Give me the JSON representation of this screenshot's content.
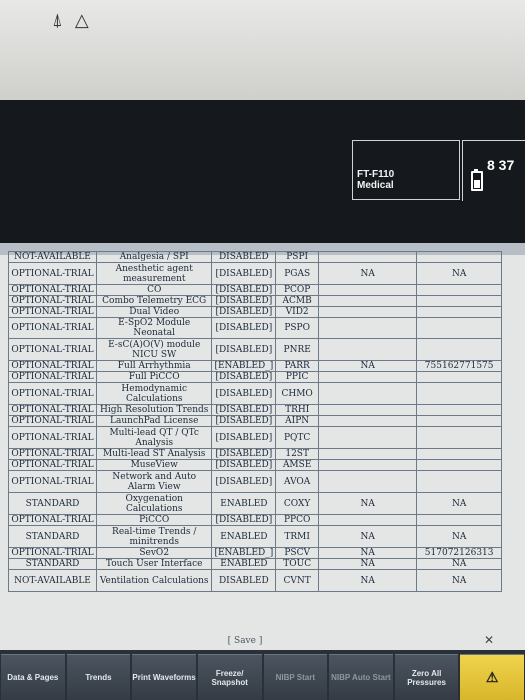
{
  "header": {
    "device_line1": "FT-F110",
    "device_line2": "Medical",
    "clock": "8 37"
  },
  "bezel": {
    "icons": [
      "alarm-silence-icon",
      "warning-triangle-icon"
    ]
  },
  "table": {
    "rows": [
      [
        "NOT-AVAILABLE",
        "Analgesia / SPI",
        "DISABLED",
        "PSPI",
        "",
        ""
      ],
      [
        "OPTIONAL-TRIAL",
        "Anesthetic agent measurement",
        "[DISABLED]",
        "PGAS",
        "NA",
        "NA"
      ],
      [
        "OPTIONAL-TRIAL",
        "CO",
        "[DISABLED]",
        "PCOP",
        "",
        ""
      ],
      [
        "OPTIONAL-TRIAL",
        "Combo Telemetry ECG",
        "[DISABLED]",
        "ACMB",
        "",
        ""
      ],
      [
        "OPTIONAL-TRIAL",
        "Dual Video",
        "[DISABLED]",
        "VID2",
        "",
        ""
      ],
      [
        "OPTIONAL-TRIAL",
        "E-SpO2 Module Neonatal",
        "[DISABLED]",
        "PSPO",
        "",
        ""
      ],
      [
        "OPTIONAL-TRIAL",
        "E-sC(A)O(V) module NICU SW",
        "[DISABLED]",
        "PNRE",
        "",
        ""
      ],
      [
        "OPTIONAL-TRIAL",
        "Full Arrhythmia",
        "[ENABLED_]",
        "PARR",
        "NA",
        "755162771575"
      ],
      [
        "OPTIONAL-TRIAL",
        "Full PiCCO",
        "[DISABLED]",
        "PPIC",
        "",
        ""
      ],
      [
        "OPTIONAL-TRIAL",
        "Hemodynamic Calculations",
        "[DISABLED]",
        "CHMO",
        "",
        ""
      ],
      [
        "OPTIONAL-TRIAL",
        "High Resolution Trends",
        "[DISABLED]",
        "TRHI",
        "",
        ""
      ],
      [
        "OPTIONAL-TRIAL",
        "LaunchPad License",
        "[DISABLED]",
        "AIPN",
        "",
        ""
      ],
      [
        "OPTIONAL-TRIAL",
        "Multi-lead QT / QTc Analysis",
        "[DISABLED]",
        "PQTC",
        "",
        ""
      ],
      [
        "OPTIONAL-TRIAL",
        "Multi-lead ST Analysis",
        "[DISABLED]",
        "12ST",
        "",
        ""
      ],
      [
        "OPTIONAL-TRIAL",
        "MuseView",
        "[DISABLED]",
        "AMSE",
        "",
        ""
      ],
      [
        "OPTIONAL-TRIAL",
        "Network and Auto Alarm View",
        "[DISABLED]",
        "AVOA",
        "",
        ""
      ],
      [
        "STANDARD",
        "Oxygenation Calculations",
        "ENABLED",
        "COXY",
        "NA",
        "NA"
      ],
      [
        "OPTIONAL-TRIAL",
        "PiCCO",
        "[DISABLED]",
        "PPCO",
        "",
        ""
      ],
      [
        "STANDARD",
        "Real-time Trends / minitrends",
        "ENABLED",
        "TRMI",
        "NA",
        "NA"
      ],
      [
        "OPTIONAL-TRIAL",
        "SevO2",
        "[ENABLED_]",
        "PSCV",
        "NA",
        "517072126313"
      ],
      [
        "STANDARD",
        "Touch User Interface",
        "ENABLED",
        "TOUC",
        "NA",
        "NA"
      ],
      [
        "NOT-AVAILABLE",
        "Ventilation Calculations",
        "DISABLED",
        "CVNT",
        "NA",
        "NA"
      ]
    ]
  },
  "save_label": "[ Save ]",
  "softkeys": [
    {
      "label": "Data & Pages",
      "dim": false
    },
    {
      "label": "Trends",
      "dim": false
    },
    {
      "label": "Print Waveforms",
      "dim": false
    },
    {
      "label": "Freeze/ Snapshot",
      "dim": false
    },
    {
      "label": "NIBP Start",
      "dim": true
    },
    {
      "label": "NIBP Auto Start",
      "dim": true
    },
    {
      "label": "Zero All Pressures",
      "dim": false
    }
  ],
  "alarm_key_icon": "alarm-bell-icon"
}
